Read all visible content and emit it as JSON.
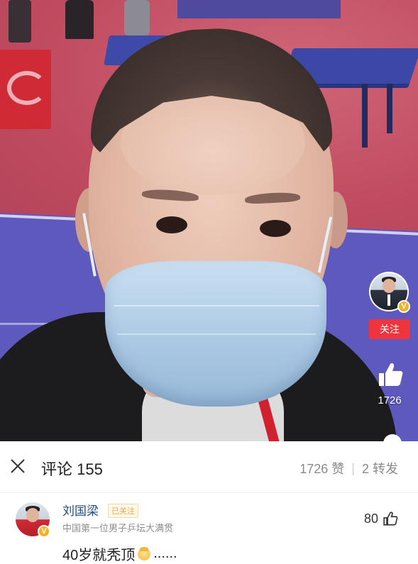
{
  "video": {
    "follow_label": "关注",
    "like_count": "1726"
  },
  "comments_panel": {
    "title": "评论 155",
    "likes_label": "1726 赞",
    "separator": "|",
    "reposts_label": "2 转发"
  },
  "comment": {
    "author": "刘国梁",
    "followed_tag": "已关注",
    "verified_desc": "中国第一位男子乒坛大满贯",
    "like_count": "80",
    "text_before_emoji": "40岁就秃顶",
    "text_after_emoji": "......"
  },
  "verified_badge": "V",
  "icons": {
    "close": "close-icon",
    "like": "thumbs-up-icon",
    "emoji": "bald-head-emoji"
  },
  "colors": {
    "follow_button": "#f0343e",
    "author_name": "#1f4c8a",
    "verified_badge": "#f2b322"
  }
}
